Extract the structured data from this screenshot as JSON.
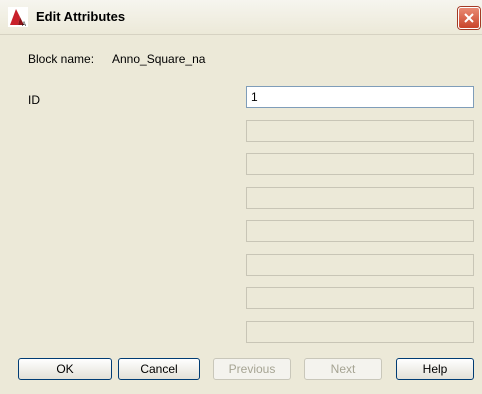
{
  "window": {
    "title": "Edit Attributes",
    "close_icon": "close-icon"
  },
  "block": {
    "label": "Block name:",
    "value": "Anno_Square_na"
  },
  "attributes": [
    {
      "label": "ID",
      "value": "1"
    }
  ],
  "empty_field_count": 7,
  "buttons": {
    "ok": "OK",
    "cancel": "Cancel",
    "previous": "Previous",
    "next": "Next",
    "help": "Help"
  }
}
